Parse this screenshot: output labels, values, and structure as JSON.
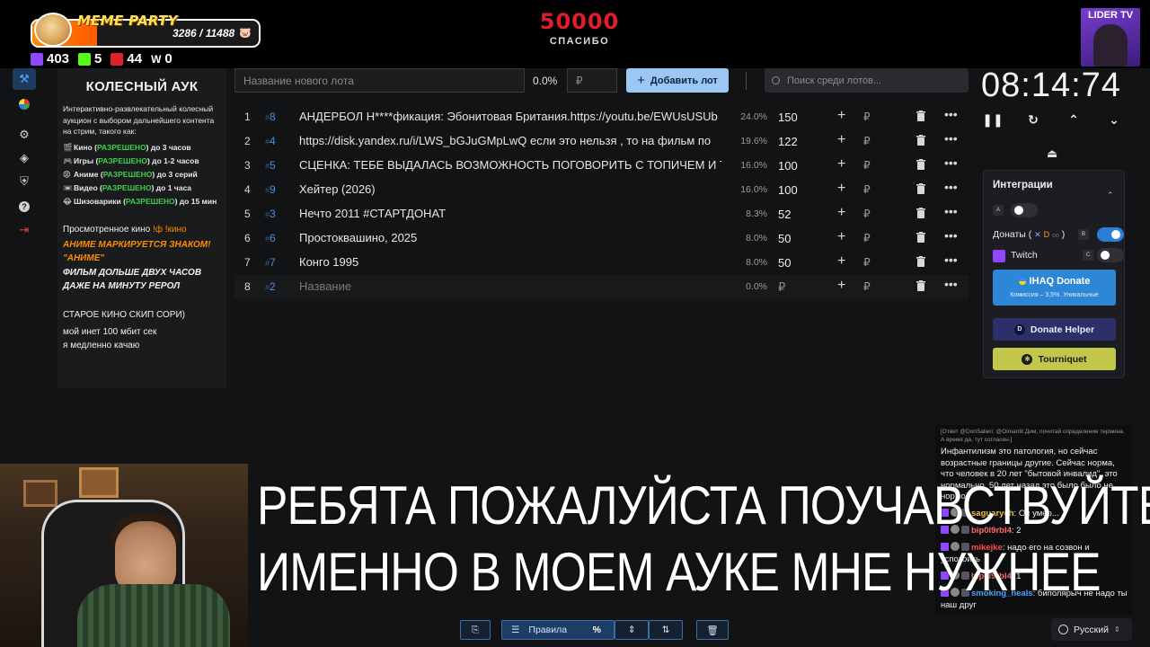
{
  "overlay": {
    "meme_party_title": "MEME PARTY",
    "meme_party_count": "3286 / 11488",
    "meme_party_progress": 0.286,
    "stats": [
      {
        "icon": "twitch-icon",
        "value": "403",
        "color": "#9146ff"
      },
      {
        "icon": "kick-icon",
        "value": "5",
        "color": "#53fc18"
      },
      {
        "icon": "live-icon",
        "value": "44",
        "color": "#e0202a"
      },
      {
        "icon": "w-icon",
        "value": "0",
        "color": "#ffffff"
      }
    ],
    "goal_amount": "50000",
    "goal_text": "СПАСИБО",
    "lider_tv": "LIDER TV"
  },
  "sidebar": {
    "items": [
      {
        "icon": "gavel-icon",
        "active": true
      },
      {
        "icon": "wheel-icon",
        "active": false
      },
      {
        "icon": "gear-icon",
        "active": false
      },
      {
        "icon": "layers-icon",
        "active": false
      },
      {
        "icon": "shield-icon",
        "active": false
      },
      {
        "icon": "help-icon",
        "active": false
      },
      {
        "icon": "logout-icon",
        "active": false
      }
    ]
  },
  "info": {
    "title": "КОЛЕСНЫЙ АУК",
    "description": "Интерактивно-развлекательный колесный аукцион с выбором дальнейшего контента на стрим, такого как:",
    "rules": [
      {
        "emoji": "🎬",
        "pre": "Кино (",
        "ok": "РАЗРЕШЕНО",
        "post": ") до 3 часов"
      },
      {
        "emoji": "🎮",
        "pre": "Игры (",
        "ok": "РАЗРЕШЕНО",
        "post": ") до 1-2 часов"
      },
      {
        "emoji": "😡",
        "pre": "Аниме (",
        "ok": "РАЗРЕШЕНО",
        "post": ") до 3 серий"
      },
      {
        "emoji": "📼",
        "pre": "Видео (",
        "ok": "РАЗРЕШЕНО",
        "post": ") до 1 часа"
      },
      {
        "emoji": "😂",
        "pre": "Шизоварики (",
        "ok": "РАЗРЕШЕНО",
        "post": ") до 15 мин"
      }
    ],
    "watched_prefix": "Просмотренное кино ",
    "watched_cmd": "!ф !кино",
    "anime_line1": "АНИМЕ МАРКИРУЕТСЯ ЗНАКОМ!",
    "anime_line2": "\"АНИМЕ\"",
    "film_line1": "ФИЛЬМ ДОЛЬШЕ ДВУХ ЧАСОВ",
    "film_line2": "ДАЖЕ НА МИНУТУ РЕРОЛ",
    "old_cinema": "СТАРОЕ КИНО СКИП СОРИ)",
    "net_line1": "мой инет 100 мбит сек",
    "net_line2": "я медленно качаю"
  },
  "lot_form": {
    "name_placeholder": "Название нового лота",
    "percent": "0.0%",
    "amount_placeholder": "₽",
    "add_button": "Добавить лот",
    "search_placeholder": "Поиск среди лотов..."
  },
  "lots": [
    {
      "idx": "1",
      "hash": "8",
      "name": "АНДЕРБОЛ Н****фикация: Эбонитовая Британия.https://youtu.be/EWUsUSUb",
      "pct": "24.0%",
      "amount": "150"
    },
    {
      "idx": "2",
      "hash": "4",
      "name": "https://disk.yandex.ru/i/LWS_bGJuGMpLwQ  если это нельзя , то на фильм по",
      "pct": "19.6%",
      "amount": "122"
    },
    {
      "idx": "3",
      "hash": "5",
      "name": "СЦЕНКА: ТЕБЕ ВЫДАЛАСЬ ВОЗМОЖНОСТЬ ПОГОВОРИТЬ С ТОПИЧЕМ И ТЕ",
      "pct": "16.0%",
      "amount": "100"
    },
    {
      "idx": "4",
      "hash": "9",
      "name": "Хейтер (2026)",
      "pct": "16.0%",
      "amount": "100"
    },
    {
      "idx": "5",
      "hash": "3",
      "name": "Нечто 2011 #СТАРТДОНАТ",
      "pct": "8.3%",
      "amount": "52"
    },
    {
      "idx": "6",
      "hash": "6",
      "name": "Простоквашино, 2025",
      "pct": "8.0%",
      "amount": "50"
    },
    {
      "idx": "7",
      "hash": "7",
      "name": "Конго 1995",
      "pct": "8.0%",
      "amount": "50"
    },
    {
      "idx": "8",
      "hash": "2",
      "name": "Название",
      "pct": "0.0%",
      "amount": "₽",
      "placeholder": true
    }
  ],
  "rub_symbol": "₽",
  "timer": {
    "value": "08:14:74"
  },
  "integrations": {
    "title": "Интеграции",
    "hotkey_a": "A",
    "donations_label": "Донаты (",
    "donations_close": ")",
    "hotkey_b": "B",
    "twitch_label": "Twitch",
    "hotkey_c": "C",
    "ihaq_title": "IHAQ Donate",
    "ihaq_sub": "Комиссия – 3,5%. Уникальные",
    "donate_helper": "Donate Helper",
    "tourniquet": "Tourniquet"
  },
  "chat": {
    "reply": "[Ответ @DonSalieri: @Oimanlit Дим, почитай определение термина. А время да, тут согласен.]",
    "msg0": "Инфантилизм это патология, но сейчас возрастные границы другие. Сейчас норма, что человек в 20 лет \"бытовой инвалид\", это нормально, 50 лет назад это было было не нормой",
    "messages": [
      {
        "user": "saguarych",
        "color": "#f0c040",
        "text": "Он умер..."
      },
      {
        "user": "bip0l9rbl4",
        "color": "#ff6a6a",
        "text": "2"
      },
      {
        "user": "mikejke",
        "color": "#ff4a4a",
        "text": "надо его на созвон и успокоить"
      },
      {
        "user": "bip0l9rbl4",
        "color": "#ff6a6a",
        "text": "1"
      },
      {
        "user": "smoking_heals",
        "color": "#4aa3ff",
        "text": "биполярыч не надо ты наш друг"
      }
    ],
    "language": "Русский"
  },
  "caption": {
    "line1": "РЕБЯТА ПОЖАЛУЙСТА ПОУЧАВСТВУЙТЕ",
    "line2": "ИМЕННО В МОЕМ АУКЕ МНЕ НУЖНЕЕ"
  },
  "toolbar": {
    "rules_label": "Правила",
    "percent_label": "%"
  }
}
